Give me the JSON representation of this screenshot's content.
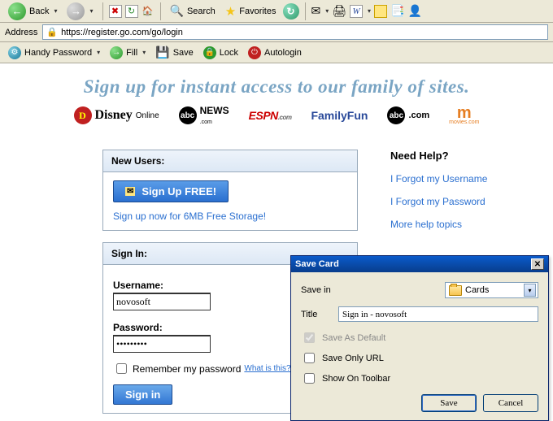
{
  "ie": {
    "back": "Back",
    "search": "Search",
    "favorites": "Favorites",
    "addressLabel": "Address",
    "url": "https://register.go.com/go/login"
  },
  "hp": {
    "brand": "Handy Password",
    "fill": "Fill",
    "save": "Save",
    "lock": "Lock",
    "autologin": "Autologin"
  },
  "banner": "Sign up for instant access to our family of sites.",
  "logos": {
    "disneyOnline": "Disney Online",
    "abcNews": "NEWS",
    "abcNewsSub": ".com",
    "espn": "ESPN",
    "familyFun": "FamilyFun",
    "abcCom": ".com",
    "movies": "movies.com"
  },
  "newUsers": {
    "heading": "New Users:",
    "signupBtn": "Sign Up FREE!",
    "storageLink": "Sign up now for 6MB Free Storage!"
  },
  "help": {
    "heading": "Need Help?",
    "forgotUser": "I Forgot my Username",
    "forgotPass": "I Forgot my Password",
    "moreTopics": "More help topics"
  },
  "signin": {
    "heading": "Sign In:",
    "userLabel": "Username:",
    "userValue": "novosoft",
    "passLabel": "Password:",
    "passValue": "•••••••••",
    "remember": "Remember my password",
    "whatIs": "What is this?",
    "btn": "Sign in"
  },
  "dialog": {
    "title": "Save Card",
    "saveInLabel": "Save in",
    "saveInValue": "Cards",
    "titleLabel": "Title",
    "titleValue": "Sign in - novosoft",
    "saveDefault": "Save As Default",
    "saveUrlOnly": "Save Only URL",
    "showToolbar": "Show On Toolbar",
    "saveBtn": "Save",
    "cancelBtn": "Cancel"
  }
}
